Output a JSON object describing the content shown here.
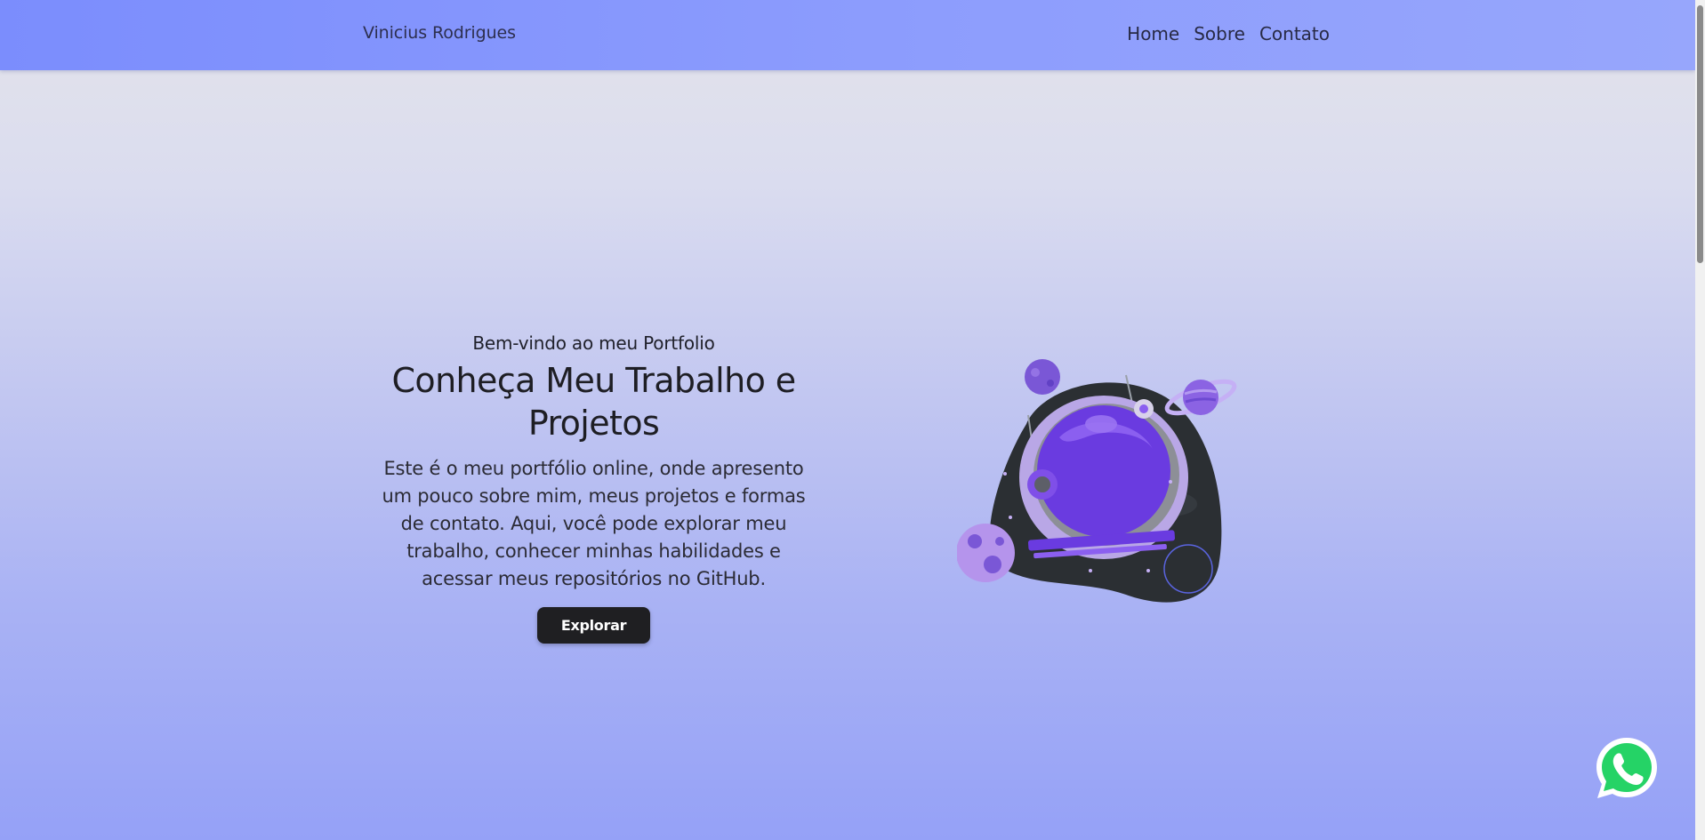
{
  "nav": {
    "brand": "Vinicius Rodrigues",
    "links": [
      {
        "label": "Home"
      },
      {
        "label": "Sobre"
      },
      {
        "label": "Contato"
      }
    ]
  },
  "hero": {
    "kicker": "Bem-vindo ao meu Portfolio",
    "headline_line1": "Conheça Meu Trabalho e",
    "headline_line2": "Projetos",
    "intro": "Este é o meu portfólio online, onde apresento um pouco sobre mim, meus projetos e formas de contato. Aqui, você pode explorar meu trabalho, conhecer minhas habilidades e acessar meus repositórios no GitHub.",
    "button_label": "Explorar"
  },
  "illustration": {
    "icon": "astronaut-helmet-space-illustration"
  },
  "floating": {
    "icon": "whatsapp-icon"
  },
  "colors": {
    "nav_bg": "#8394fd",
    "button_bg": "#1f1f22",
    "accent_purple": "#6a3be0",
    "whatsapp_green": "#25d366"
  }
}
